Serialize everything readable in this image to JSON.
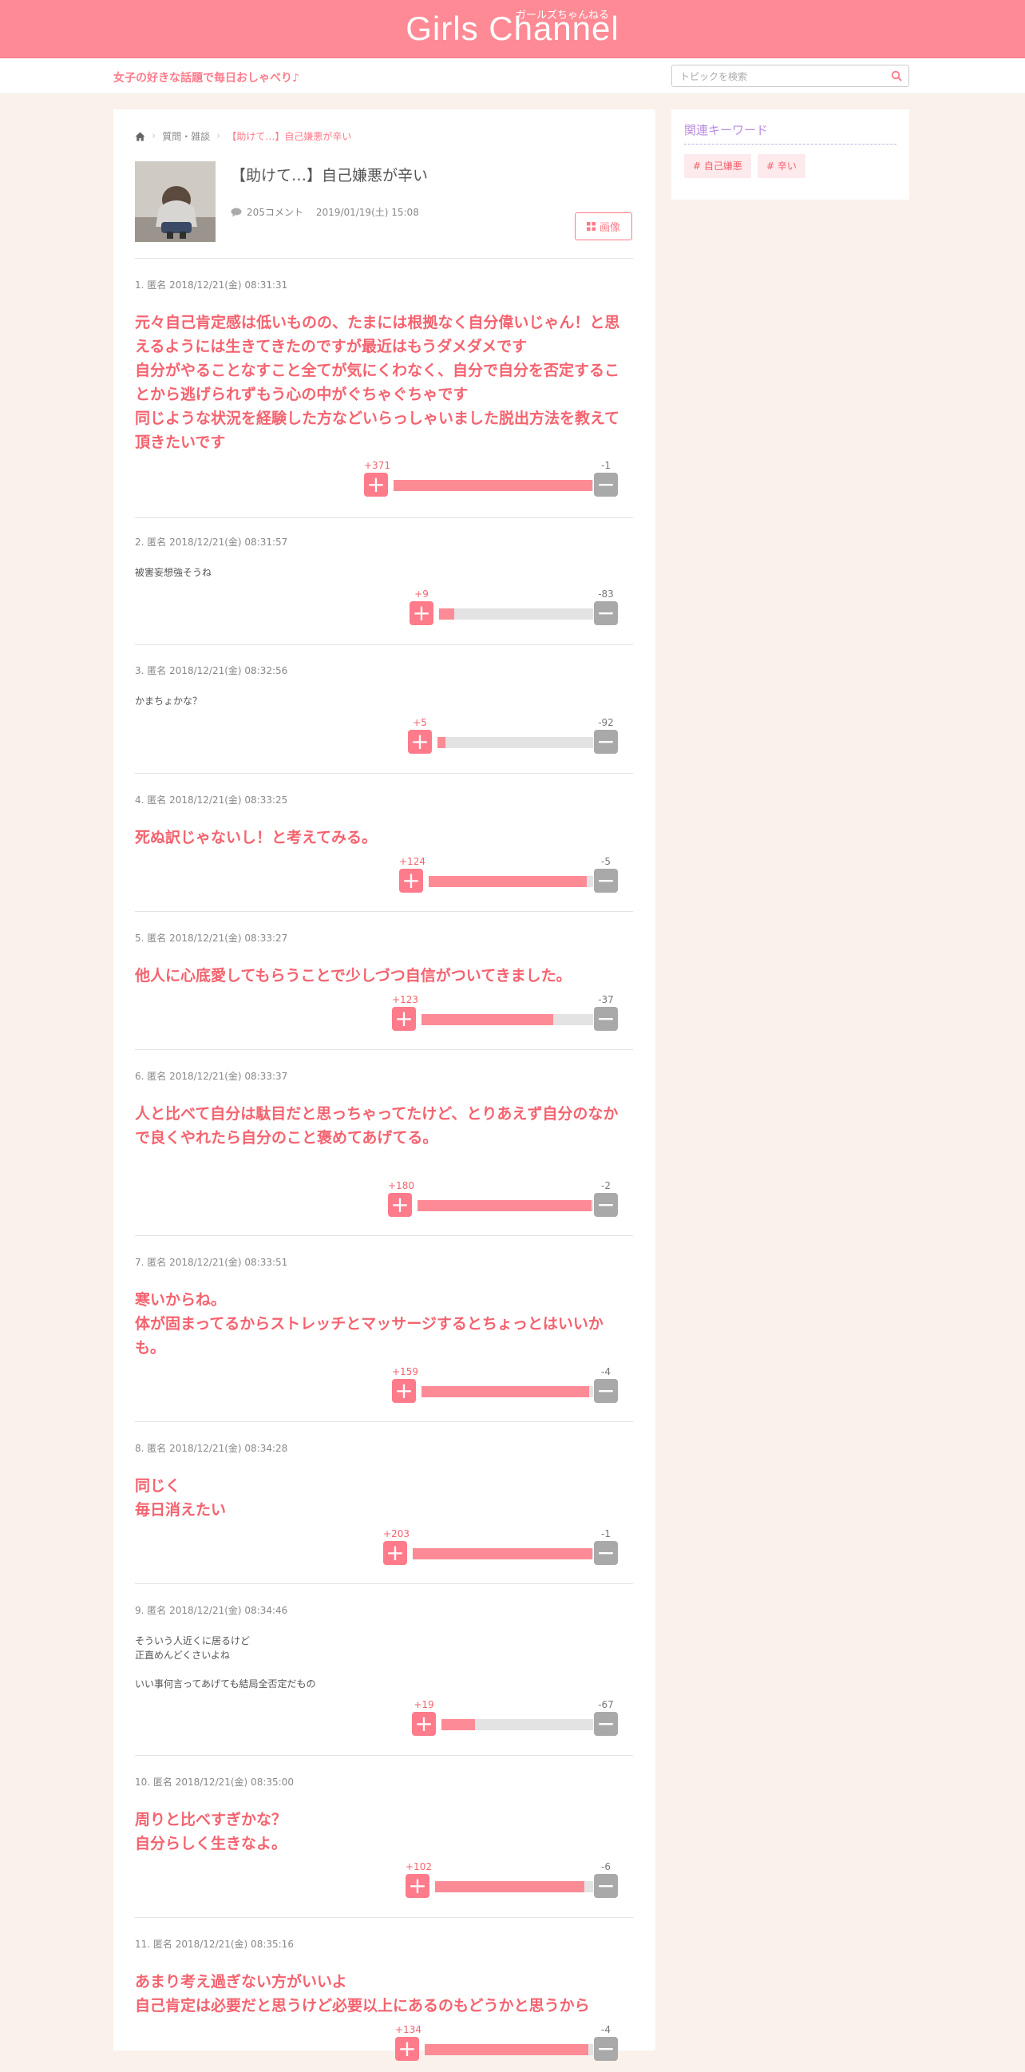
{
  "header": {
    "logo": "Girls Channel",
    "logo_kana": "ガールズちゃんねる",
    "tagline": "女子の好きな話題で毎日おしゃべり♪",
    "search_placeholder": "トピックを検索",
    "accent_color": "#fd8a95"
  },
  "breadcrumb": {
    "home_icon": "home-icon",
    "category": "質問・雑談",
    "current": "【助けて…】自己嫌悪が辛い"
  },
  "topic": {
    "title": "【助けて…】自己嫌悪が辛い",
    "comment_count": "205コメント",
    "date": "2019/01/19(土) 15:08",
    "image_button": "画像"
  },
  "comments": [
    {
      "header": "1. 匿名 2018/12/21(金) 08:31:31",
      "body": "元々自己肯定感は低いものの、たまには根拠なく自分偉いじゃん！と思えるようには生きてきたのですが最近はもうダメダメです\n自分がやることなすこと全てが気にくわなく、自分で自分を否定することから逃げられずもう心の中がぐちゃぐちゃです\n同じような状況を経験した方などいらっしゃいました脱出方法を教えて頂きたいです",
      "plus": "+371",
      "minus": "-1",
      "ratio": 0.997
    },
    {
      "header": "2. 匿名 2018/12/21(金) 08:31:57",
      "body": "被害妄想強そうね",
      "plus": "+9",
      "minus": "-83",
      "ratio": 0.098
    },
    {
      "header": "3. 匿名 2018/12/21(金) 08:32:56",
      "body": "かまちょかな？",
      "plus": "+5",
      "minus": "-92",
      "ratio": 0.052
    },
    {
      "header": "4. 匿名 2018/12/21(金) 08:33:25",
      "body": "死ぬ訳じゃないし！と考えてみる。",
      "plus": "+124",
      "minus": "-5",
      "ratio": 0.961
    },
    {
      "header": "5. 匿名 2018/12/21(金) 08:33:27",
      "body": "他人に心底愛してもらうことで少しづつ自信がついてきました。",
      "plus": "+123",
      "minus": "-37",
      "ratio": 0.769
    },
    {
      "header": "6. 匿名 2018/12/21(金) 08:33:37",
      "body": "人と比べて自分は駄目だと思っちゃってたけど、とりあえず自分のなかで良くやれたら自分のこと褒めてあげてる。",
      "plus": "+180",
      "minus": "-2",
      "ratio": 0.989
    },
    {
      "header": "7. 匿名 2018/12/21(金) 08:33:51",
      "body": "寒いからね。\n体が固まってるからストレッチとマッサージするとちょっとはいいかも。",
      "plus": "+159",
      "minus": "-4",
      "ratio": 0.975
    },
    {
      "header": "8. 匿名 2018/12/21(金) 08:34:28",
      "body": "同じく\n毎日消えたい",
      "plus": "+203",
      "minus": "-1",
      "ratio": 0.995
    },
    {
      "header": "9. 匿名 2018/12/21(金) 08:34:46",
      "body": "そういう人近くに居るけど\n正直めんどくさいよね\n\nいい事何言ってあげても結局全否定だもの",
      "plus": "+19",
      "minus": "-67",
      "ratio": 0.221
    },
    {
      "header": "10. 匿名 2018/12/21(金) 08:35:00",
      "body": "周りと比べすぎかな？\n自分らしく生きなよ。",
      "plus": "+102",
      "minus": "-6",
      "ratio": 0.944
    },
    {
      "header": "11. 匿名 2018/12/21(金) 08:35:16",
      "body": "あまり考え過ぎない方がいいよ\n自己肯定は必要だと思うけど必要以上にあるのもどうかと思うから",
      "plus": "+134",
      "minus": "-4",
      "ratio": 0.971
    }
  ],
  "sidebar": {
    "title": "関連キーワード",
    "keywords": [
      "# 自己嫌悪",
      "# 辛い"
    ]
  }
}
